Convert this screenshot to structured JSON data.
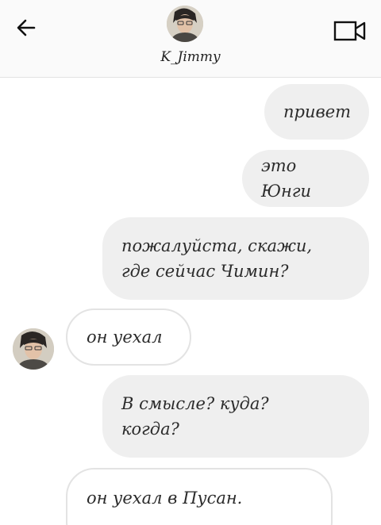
{
  "header": {
    "username": "K_Jimmy",
    "back_icon": "arrow-left-icon",
    "video_icon": "video-camera-icon"
  },
  "messages": [
    {
      "direction": "out",
      "text": "привет"
    },
    {
      "direction": "out",
      "text": "это Юнги"
    },
    {
      "direction": "out",
      "line1": "пожалуйста, скажи,",
      "line2": "где сейчас Чимин?"
    },
    {
      "direction": "in",
      "text": "он уехал"
    },
    {
      "direction": "out",
      "line1": "В смысле? куда?",
      "line2": "когда?"
    },
    {
      "direction": "in",
      "line1": "он уехал в Пусан."
    }
  ],
  "colors": {
    "outgoing_bubble": "#efefef",
    "incoming_bubble_border": "#e3e3e3",
    "header_bg": "#fafafa"
  }
}
